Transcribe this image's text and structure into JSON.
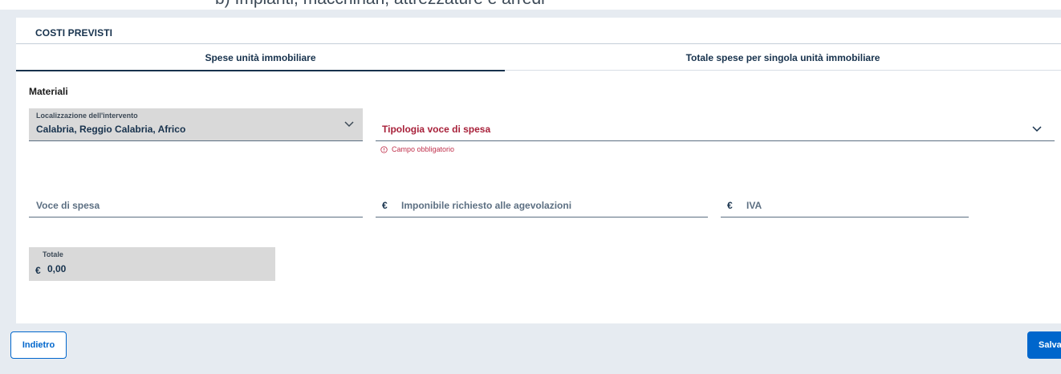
{
  "top_cut_text": "b) Impianti, macchinari, attrezzature e arredi",
  "card": {
    "title": "COSTI PREVISTI",
    "tabs": [
      {
        "label": "Spese unità immobiliare",
        "active": true
      },
      {
        "label": "Totale spese per singola unità immobiliare",
        "active": false
      }
    ],
    "section_label": "Materiali"
  },
  "form": {
    "localizzazione": {
      "label": "Localizzazione dell'intervento",
      "value": "Calabria, Reggio Calabria, Africo"
    },
    "tipologia": {
      "label": "Tipologia voce di spesa",
      "error": "Campo obbligatorio"
    },
    "voce": {
      "label": "Voce di spesa"
    },
    "imponibile": {
      "currency": "€",
      "label": "Imponibile richiesto alle agevolazioni"
    },
    "iva": {
      "currency": "€",
      "label": "IVA"
    },
    "totale": {
      "label": "Totale",
      "currency": "€",
      "value": "0,00"
    }
  },
  "actions": {
    "back_label": "Indietro",
    "save_label": "Salva"
  },
  "colors": {
    "primary": "#0066cc",
    "error": "#a8213a",
    "text": "#17324d",
    "background": "#e6ebf1"
  },
  "icons": {
    "dropdown": "chevron-down-icon",
    "error": "alert-circle-icon"
  }
}
